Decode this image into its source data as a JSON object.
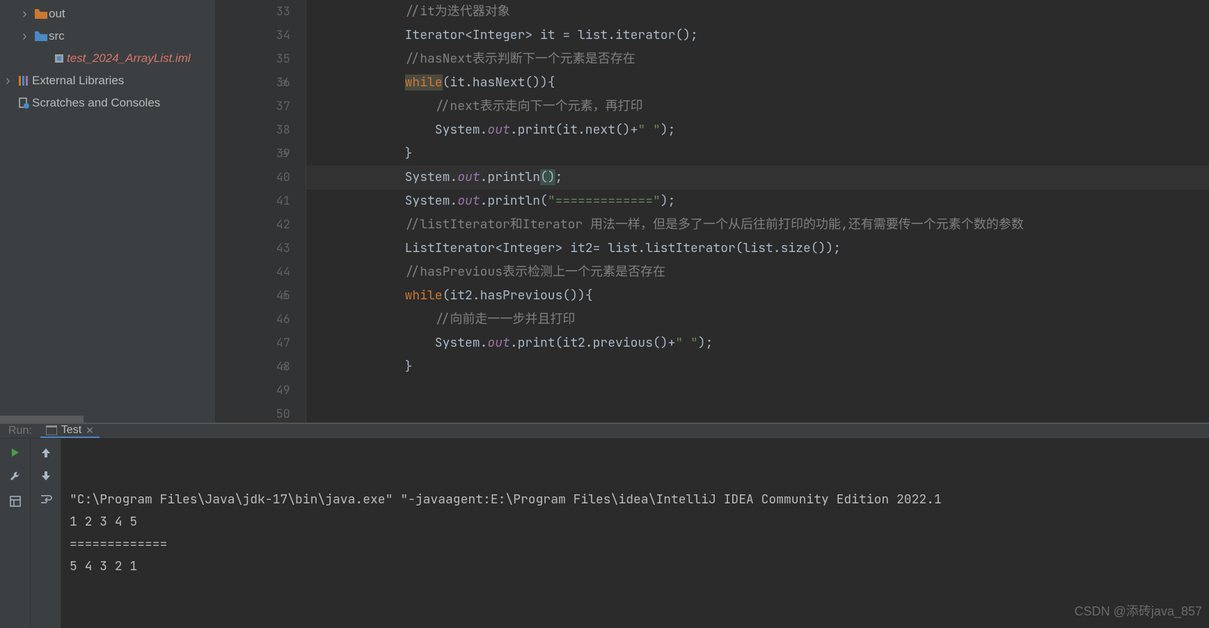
{
  "sidebar": {
    "items": [
      {
        "label": "out",
        "kind": "folder-orange",
        "indent": 1,
        "chevron": true
      },
      {
        "label": "src",
        "kind": "folder-blue",
        "indent": 1,
        "chevron": true
      },
      {
        "label": "test_2024_ArrayList.iml",
        "kind": "iml",
        "indent": 2,
        "chevron": false
      },
      {
        "label": "External Libraries",
        "kind": "lib",
        "indent": 0,
        "chevron": true
      },
      {
        "label": "Scratches and Consoles",
        "kind": "scratch",
        "indent": 0,
        "chevron": false
      }
    ]
  },
  "editor": {
    "line_start": 33,
    "line_end": 50,
    "current_line": 40,
    "lines": {
      "33": {
        "indent": "            ",
        "tokens": [
          {
            "t": "comment",
            "v": "//it为迭代器对象"
          }
        ]
      },
      "34": {
        "indent": "            ",
        "tokens": [
          {
            "t": "plain",
            "v": "Iterator<Integer> it = list.iterator();"
          }
        ]
      },
      "35": {
        "indent": "            ",
        "tokens": [
          {
            "t": "comment",
            "v": "//hasNext表示判断下一个元素是否存在"
          }
        ]
      },
      "36": {
        "indent": "            ",
        "tokens": [
          {
            "t": "hlkw",
            "v": "while"
          },
          {
            "t": "plain",
            "v": "(it.hasNext()){"
          }
        ]
      },
      "37": {
        "indent": "                ",
        "tokens": [
          {
            "t": "comment",
            "v": "//next表示走向下一个元素，再打印"
          }
        ]
      },
      "38": {
        "indent": "                ",
        "tokens": [
          {
            "t": "plain",
            "v": "System."
          },
          {
            "t": "static",
            "v": "out"
          },
          {
            "t": "plain",
            "v": ".print(it.next()+"
          },
          {
            "t": "str",
            "v": "\" \""
          },
          {
            "t": "plain",
            "v": ");"
          }
        ]
      },
      "39": {
        "indent": "            ",
        "tokens": [
          {
            "t": "plain",
            "v": "}"
          }
        ]
      },
      "40": {
        "indent": "            ",
        "tokens": [
          {
            "t": "plain",
            "v": "System."
          },
          {
            "t": "static",
            "v": "out"
          },
          {
            "t": "plain",
            "v": ".println"
          },
          {
            "t": "caret",
            "v": "()"
          },
          {
            "t": "plain",
            "v": ";"
          }
        ]
      },
      "41": {
        "indent": "            ",
        "tokens": [
          {
            "t": "plain",
            "v": "System."
          },
          {
            "t": "static",
            "v": "out"
          },
          {
            "t": "plain",
            "v": ".println("
          },
          {
            "t": "str",
            "v": "\"=============\""
          },
          {
            "t": "plain",
            "v": ");"
          }
        ]
      },
      "42": {
        "indent": "            ",
        "tokens": [
          {
            "t": "comment",
            "v": "//listIterator和Iterator 用法一样，但是多了一个从后往前打印的功能,还有需要传一个元素个数的参数"
          }
        ]
      },
      "43": {
        "indent": "            ",
        "tokens": [
          {
            "t": "plain",
            "v": "ListIterator<Integer> it2= list.listIterator(list.size());"
          }
        ]
      },
      "44": {
        "indent": "            ",
        "tokens": [
          {
            "t": "comment",
            "v": "//hasPrevious表示检测上一个元素是否存在"
          }
        ]
      },
      "45": {
        "indent": "            ",
        "tokens": [
          {
            "t": "kw",
            "v": "while"
          },
          {
            "t": "plain",
            "v": "(it2.hasPrevious()){"
          }
        ]
      },
      "46": {
        "indent": "                ",
        "tokens": [
          {
            "t": "comment",
            "v": "//向前走一一步并且打印"
          }
        ]
      },
      "47": {
        "indent": "                ",
        "tokens": [
          {
            "t": "plain",
            "v": "System."
          },
          {
            "t": "static",
            "v": "out"
          },
          {
            "t": "plain",
            "v": ".print(it2.previous()+"
          },
          {
            "t": "str",
            "v": "\" \""
          },
          {
            "t": "plain",
            "v": ");"
          }
        ]
      },
      "48": {
        "indent": "            ",
        "tokens": [
          {
            "t": "plain",
            "v": "}"
          }
        ]
      },
      "49": {
        "indent": "",
        "tokens": []
      },
      "50": {
        "indent": "",
        "tokens": []
      }
    },
    "fold_markers": {
      "36": "open",
      "39": "close",
      "45": "open",
      "48": "close"
    }
  },
  "run": {
    "panel_label": "Run:",
    "tab_name": "Test",
    "output_lines": [
      "\"C:\\Program Files\\Java\\jdk-17\\bin\\java.exe\" \"-javaagent:E:\\Program Files\\idea\\IntelliJ IDEA Community Edition 2022.1",
      "1 2 3 4 5 ",
      "=============",
      "5 4 3 2 1 "
    ]
  },
  "watermark": "CSDN @添砖java_857",
  "icons": {
    "run": "run-icon",
    "wrench": "wrench-icon",
    "layout": "layout-icon",
    "up": "up-arrow-icon",
    "down": "down-arrow-icon",
    "wrap": "wrap-icon",
    "terminal": "terminal-icon"
  }
}
